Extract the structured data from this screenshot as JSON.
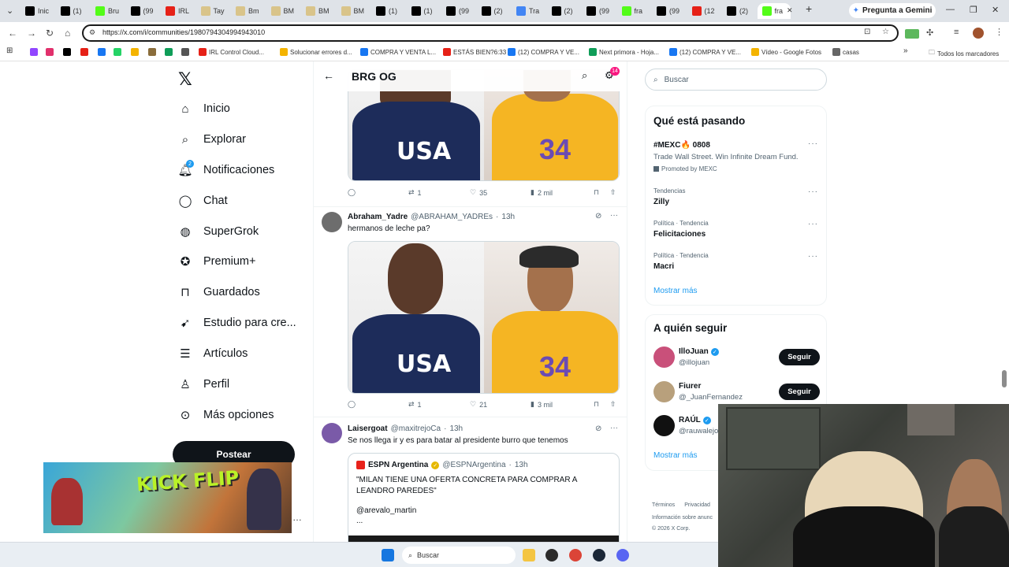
{
  "browser": {
    "tabs": [
      {
        "label": "Inic",
        "icon": "x-icon",
        "color": "#000000"
      },
      {
        "label": "(1)",
        "icon": "x-icon",
        "color": "#000000"
      },
      {
        "label": "Bru",
        "icon": "kick-icon",
        "color": "#53fc18"
      },
      {
        "label": "(99",
        "icon": "tiktok-icon",
        "color": "#000000"
      },
      {
        "label": "IRL",
        "icon": "youtube-icon",
        "color": "#e62117"
      },
      {
        "label": "Tay",
        "icon": "pill-icon",
        "color": "#d9c48a"
      },
      {
        "label": "Bm",
        "icon": "pill-icon",
        "color": "#d9c48a"
      },
      {
        "label": "BM",
        "icon": "pill-icon",
        "color": "#d9c48a"
      },
      {
        "label": "BM",
        "icon": "pill-icon",
        "color": "#d9c48a"
      },
      {
        "label": "BM",
        "icon": "pill-icon",
        "color": "#d9c48a"
      },
      {
        "label": "(1)",
        "icon": "x-icon",
        "color": "#000000"
      },
      {
        "label": "(1)",
        "icon": "x-icon",
        "color": "#000000"
      },
      {
        "label": "(99",
        "icon": "tiktok-icon",
        "color": "#000000"
      },
      {
        "label": "(2)",
        "icon": "x-icon",
        "color": "#000000"
      },
      {
        "label": "Tra",
        "icon": "translate-icon",
        "color": "#4285f4"
      },
      {
        "label": "(2)",
        "icon": "x-icon",
        "color": "#000000"
      },
      {
        "label": "(99",
        "icon": "tiktok-icon",
        "color": "#000000"
      },
      {
        "label": "fra",
        "icon": "kick-icon",
        "color": "#53fc18"
      },
      {
        "label": "(99",
        "icon": "tiktok-icon",
        "color": "#000000"
      },
      {
        "label": "(12",
        "icon": "youtube-icon",
        "color": "#e62117"
      },
      {
        "label": "(2)",
        "icon": "x-icon",
        "color": "#000000"
      },
      {
        "label": "fra",
        "icon": "kick-icon",
        "color": "#53fc18"
      }
    ],
    "gemini_label": "Pregunta a Gemini",
    "url": "https://x.com/i/communities/1980794304994943010",
    "bookmarks": [
      {
        "label": "",
        "color": "#9146ff"
      },
      {
        "label": "",
        "color": "#e1306c"
      },
      {
        "label": "",
        "color": "#000000"
      },
      {
        "label": "",
        "color": "#e62117"
      },
      {
        "label": "",
        "color": "#1877f2"
      },
      {
        "label": "",
        "color": "#25d366"
      },
      {
        "label": "",
        "color": "#f4b400"
      },
      {
        "label": "",
        "color": "#8a6d3b"
      },
      {
        "label": "",
        "color": "#0f9d58"
      },
      {
        "label": "",
        "color": "#555555"
      },
      {
        "label": "IRL Control Cloud...",
        "color": "#e62117"
      },
      {
        "label": "Solucionar errores d...",
        "color": "#f4b400"
      },
      {
        "label": "COMPRA Y VENTA L...",
        "color": "#1877f2"
      },
      {
        "label": "ESTÁS BIEN?6:33",
        "color": "#e62117"
      },
      {
        "label": "(12) COMPRA Y VE...",
        "color": "#1877f2"
      },
      {
        "label": "Next primora - Hoja...",
        "color": "#0f9d58"
      },
      {
        "label": "(12) COMPRA Y VE...",
        "color": "#1877f2"
      },
      {
        "label": "Vídeo - Google Fotos",
        "color": "#f4b400"
      },
      {
        "label": "casas",
        "color": "#666666"
      }
    ],
    "all_bookmarks": "Todos los marcadores"
  },
  "nav": {
    "items": [
      {
        "label": "Inicio",
        "icon": "home-icon"
      },
      {
        "label": "Explorar",
        "icon": "search-icon"
      },
      {
        "label": "Notificaciones",
        "icon": "bell-icon",
        "badge": "2"
      },
      {
        "label": "Chat",
        "icon": "chat-icon"
      },
      {
        "label": "SuperGrok",
        "icon": "grok-icon"
      },
      {
        "label": "Premium+",
        "icon": "verified-icon"
      },
      {
        "label": "Guardados",
        "icon": "bookmark-icon"
      },
      {
        "label": "Estudio para cre...",
        "icon": "rocket-icon"
      },
      {
        "label": "Artículos",
        "icon": "article-icon"
      },
      {
        "label": "Perfil",
        "icon": "person-icon"
      },
      {
        "label": "Más opciones",
        "icon": "more-icon"
      }
    ],
    "post_label": "Postear"
  },
  "header": {
    "title": "BRG OG",
    "settings_badge": "14"
  },
  "tweets": [
    {
      "stats": {
        "replies": "",
        "retweets": "1",
        "likes": "35",
        "views": "2 mil"
      },
      "image_text_left": "USA",
      "image_text_right": "34"
    },
    {
      "name": "Abraham_Yadre",
      "handle": "@ABRAHAM_YADREs",
      "time": "13h",
      "text": "hermanos de leche pa?",
      "image_text_left": "USA",
      "image_text_right": "34",
      "stats": {
        "replies": "",
        "retweets": "1",
        "likes": "21",
        "views": "3 mil"
      }
    },
    {
      "name": "Laisergoat",
      "handle": "@maxitrejoCa",
      "time": "13h",
      "text": "Se nos llega ir y es para batar al presidente  burro que tenemos",
      "quote": {
        "name": "ESPN Argentina",
        "handle": "@ESPNArgentina",
        "time": "13h",
        "text": "\"MILAN TIENE UNA OFERTA CONCRETA PARA COMPRAR A LEANDRO PAREDES\"",
        "mention": "@arevalo_martin",
        "ellipsis": "..."
      }
    }
  ],
  "right": {
    "search_placeholder": "Buscar",
    "trending_title": "Qué está pasando",
    "trends": [
      {
        "title": "#MEXC🔥 0808",
        "desc": "Trade Wall Street. Win Infinite Dream Fund.",
        "sub": "Promoted by MEXC"
      },
      {
        "sub": "Tendencias",
        "title": "Zilly"
      },
      {
        "sub": "Política · Tendencia",
        "title": "Felicitaciones"
      },
      {
        "sub": "Política · Tendencia",
        "title": "Macri"
      }
    ],
    "show_more": "Mostrar más",
    "follow_title": "A quién seguir",
    "follow": [
      {
        "name": "IlloJuan",
        "handle": "@illojuan",
        "button": "Seguir",
        "verified": true,
        "color": "#c9507a"
      },
      {
        "name": "Fiurer",
        "handle": "@_JuanFernandez",
        "button": "Seguir",
        "verified": false,
        "color": "#b8a07c"
      },
      {
        "name": "RAÚL",
        "handle": "@rauwalejo",
        "button": "",
        "verified": true,
        "color": "#111111"
      }
    ],
    "show_more_2": "Mostrar más",
    "footer": [
      "Términos",
      "Privacidad"
    ],
    "footer_info": "Información sobre anunc",
    "copyright": "© 2026 X Corp."
  },
  "overlay": {
    "game_title": "KICK FLIP"
  },
  "taskbar": {
    "search_label": "Buscar"
  }
}
